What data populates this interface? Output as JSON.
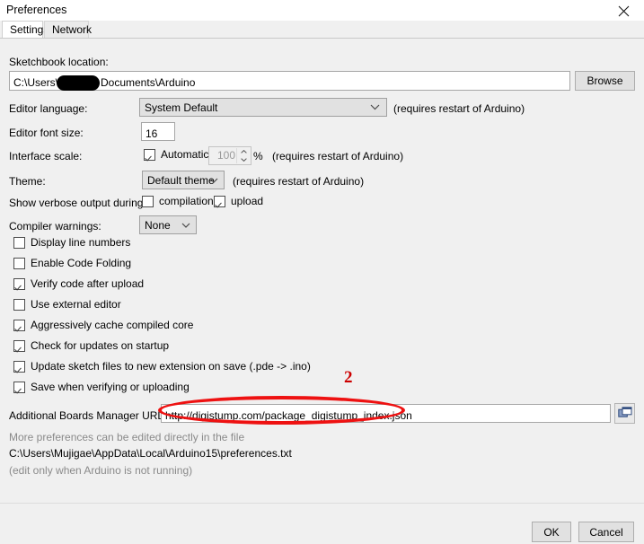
{
  "window": {
    "title": "Preferences",
    "close_icon": "close-icon"
  },
  "tabs": [
    {
      "label": "Settings",
      "active": true
    },
    {
      "label": "Network",
      "active": false
    }
  ],
  "settings": {
    "sketchbook": {
      "label": "Sketchbook location:",
      "value_prefix": "C:\\Users\\",
      "value_suffix": "Documents\\Arduino",
      "redacted": true,
      "browse_label": "Browse"
    },
    "editor_language": {
      "label": "Editor language:",
      "value": "System Default",
      "note": "(requires restart of Arduino)"
    },
    "editor_font_size": {
      "label": "Editor font size:",
      "value": "16"
    },
    "interface_scale": {
      "label": "Interface scale:",
      "automatic_label": "Automatic",
      "automatic_checked": true,
      "scale_value": "100",
      "percent": "%",
      "note": "(requires restart of Arduino)"
    },
    "theme": {
      "label": "Theme:",
      "value": "Default theme",
      "note": "(requires restart of Arduino)"
    },
    "verbose": {
      "label": "Show verbose output during:",
      "compilation_label": "compilation",
      "compilation_checked": false,
      "upload_label": "upload",
      "upload_checked": true
    },
    "compiler_warnings": {
      "label": "Compiler warnings:",
      "value": "None"
    },
    "checkboxes": [
      {
        "label": "Display line numbers",
        "checked": false
      },
      {
        "label": "Enable Code Folding",
        "checked": false
      },
      {
        "label": "Verify code after upload",
        "checked": true
      },
      {
        "label": "Use external editor",
        "checked": false
      },
      {
        "label": "Aggressively cache compiled core",
        "checked": true
      },
      {
        "label": "Check for updates on startup",
        "checked": true
      },
      {
        "label": "Update sketch files to new extension on save (.pde -> .ino)",
        "checked": true
      },
      {
        "label": "Save when verifying or uploading",
        "checked": true
      }
    ],
    "boards_urls": {
      "label": "Additional Boards Manager URLs:",
      "value": "http://digistump.com/package_digistump_index.json",
      "expand_icon": "open-window-icon"
    },
    "footnotes": {
      "line1": "More preferences can be edited directly in the file",
      "line2": "C:\\Users\\Mujigae\\AppData\\Local\\Arduino15\\preferences.txt",
      "line3": "(edit only when Arduino is not running)"
    }
  },
  "buttons": {
    "ok": "OK",
    "cancel": "Cancel"
  },
  "annotation": {
    "number": "2",
    "color": "#ee1111"
  }
}
